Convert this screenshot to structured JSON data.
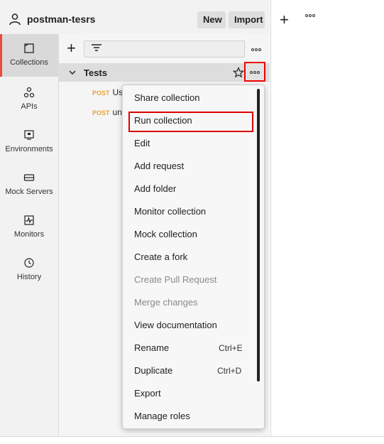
{
  "workspace": {
    "name": "postman-tesrs",
    "new_label": "New",
    "import_label": "Import"
  },
  "rail": {
    "items": [
      {
        "label": "Collections",
        "icon": "collections-icon"
      },
      {
        "label": "APIs",
        "icon": "apis-icon"
      },
      {
        "label": "Environments",
        "icon": "environments-icon"
      },
      {
        "label": "Mock Servers",
        "icon": "mock-servers-icon"
      },
      {
        "label": "Monitors",
        "icon": "monitors-icon"
      },
      {
        "label": "History",
        "icon": "history-icon"
      }
    ]
  },
  "collection": {
    "name": "Tests",
    "requests": [
      {
        "method": "POST",
        "name": "Us"
      },
      {
        "method": "POST",
        "name": "un"
      }
    ]
  },
  "menu": {
    "items": [
      {
        "label": "Share collection",
        "shortcut": "",
        "disabled": false
      },
      {
        "label": "Run collection",
        "shortcut": "",
        "disabled": false
      },
      {
        "label": "Edit",
        "shortcut": "",
        "disabled": false
      },
      {
        "label": "Add request",
        "shortcut": "",
        "disabled": false
      },
      {
        "label": "Add folder",
        "shortcut": "",
        "disabled": false
      },
      {
        "label": "Monitor collection",
        "shortcut": "",
        "disabled": false
      },
      {
        "label": "Mock collection",
        "shortcut": "",
        "disabled": false
      },
      {
        "label": "Create a fork",
        "shortcut": "",
        "disabled": false
      },
      {
        "label": "Create Pull Request",
        "shortcut": "",
        "disabled": true
      },
      {
        "label": "Merge changes",
        "shortcut": "",
        "disabled": true
      },
      {
        "label": "View documentation",
        "shortcut": "",
        "disabled": false
      },
      {
        "label": "Rename",
        "shortcut": "Ctrl+E",
        "disabled": false
      },
      {
        "label": "Duplicate",
        "shortcut": "Ctrl+D",
        "disabled": false
      },
      {
        "label": "Export",
        "shortcut": "",
        "disabled": false
      },
      {
        "label": "Manage roles",
        "shortcut": "",
        "disabled": false
      }
    ]
  },
  "colors": {
    "accent": "#e74c3c",
    "highlight_border": "#dd0000",
    "method_post": "#e8a33b"
  }
}
